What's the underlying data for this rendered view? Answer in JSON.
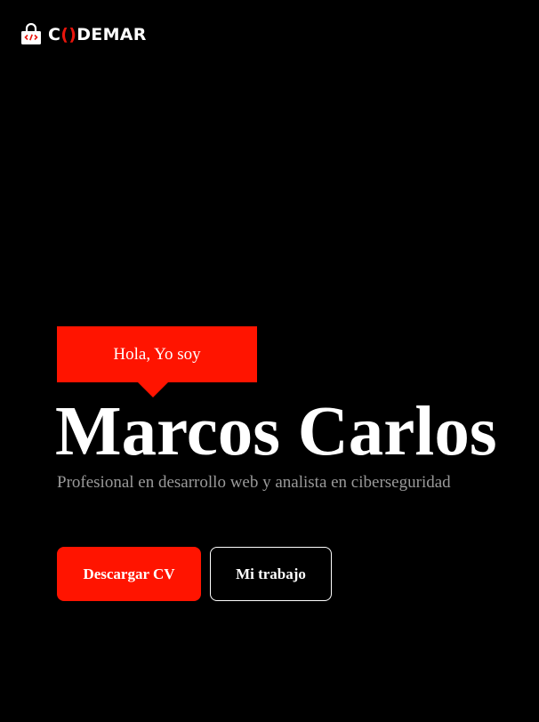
{
  "header": {
    "logo_prefix": "C",
    "logo_accent": "()",
    "logo_suffix": "DEMAR"
  },
  "hero": {
    "greeting": "Hola, Yo soy",
    "name": "Marcos Carlos",
    "subtitle": "Profesional en desarrollo web y analista en ciberseguridad"
  },
  "actions": {
    "download_cv": "Descargar CV",
    "my_work": "Mi trabajo"
  },
  "colors": {
    "accent": "#ff1400",
    "background": "#000000",
    "text": "#ffffff",
    "muted_text": "#9a9a9a"
  }
}
